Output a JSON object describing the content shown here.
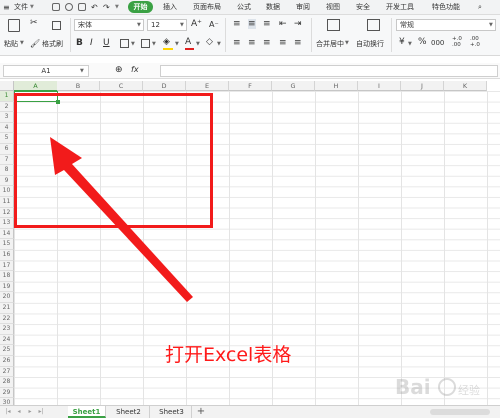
{
  "menu": {
    "file_label": "文件",
    "tabs": [
      "开始",
      "插入",
      "页面布局",
      "公式",
      "数据",
      "审阅",
      "视图",
      "安全",
      "开发工具",
      "特色功能"
    ],
    "active_tab": "开始"
  },
  "ribbon": {
    "paste_label": "粘贴",
    "cut_icon": "scissors-icon",
    "format_painter_label": "格式刷",
    "font_name": "宋体",
    "font_size": "12",
    "merge_center_label": "合并居中",
    "wrap_text_label": "自动换行",
    "number_format": "常规",
    "percent_symbol": "%",
    "thousands_symbol": "000",
    "dec_inc_label": "+.0\n.00",
    "dec_dec_label": ".00\n+.0",
    "bold": "B",
    "italic": "I",
    "underline": "U",
    "font_color_letter": "A",
    "yen_symbol": "¥"
  },
  "formula_bar": {
    "cell_ref": "A1",
    "fx_label": "fx",
    "zoom_icon": "magnifier-icon"
  },
  "grid": {
    "columns": [
      "A",
      "B",
      "C",
      "D",
      "E",
      "F",
      "G",
      "H",
      "I",
      "J",
      "K"
    ],
    "rows": [
      "1",
      "2",
      "3",
      "4",
      "5",
      "6",
      "7",
      "8",
      "9",
      "10",
      "11",
      "12",
      "13",
      "14",
      "15",
      "16",
      "17",
      "18",
      "19",
      "20",
      "21",
      "22",
      "23",
      "24",
      "25",
      "26",
      "27",
      "28",
      "29",
      "30"
    ],
    "active_cell": "A1"
  },
  "annotation": {
    "caption": "打开Excel表格",
    "color": "#ff1a1a"
  },
  "sheets": {
    "tabs": [
      "Sheet1",
      "Sheet2",
      "Sheet3"
    ],
    "active": "Sheet1",
    "add_label": "+"
  },
  "colors": {
    "accent_green": "#3aa144",
    "annotation_red": "#f21b1b"
  }
}
